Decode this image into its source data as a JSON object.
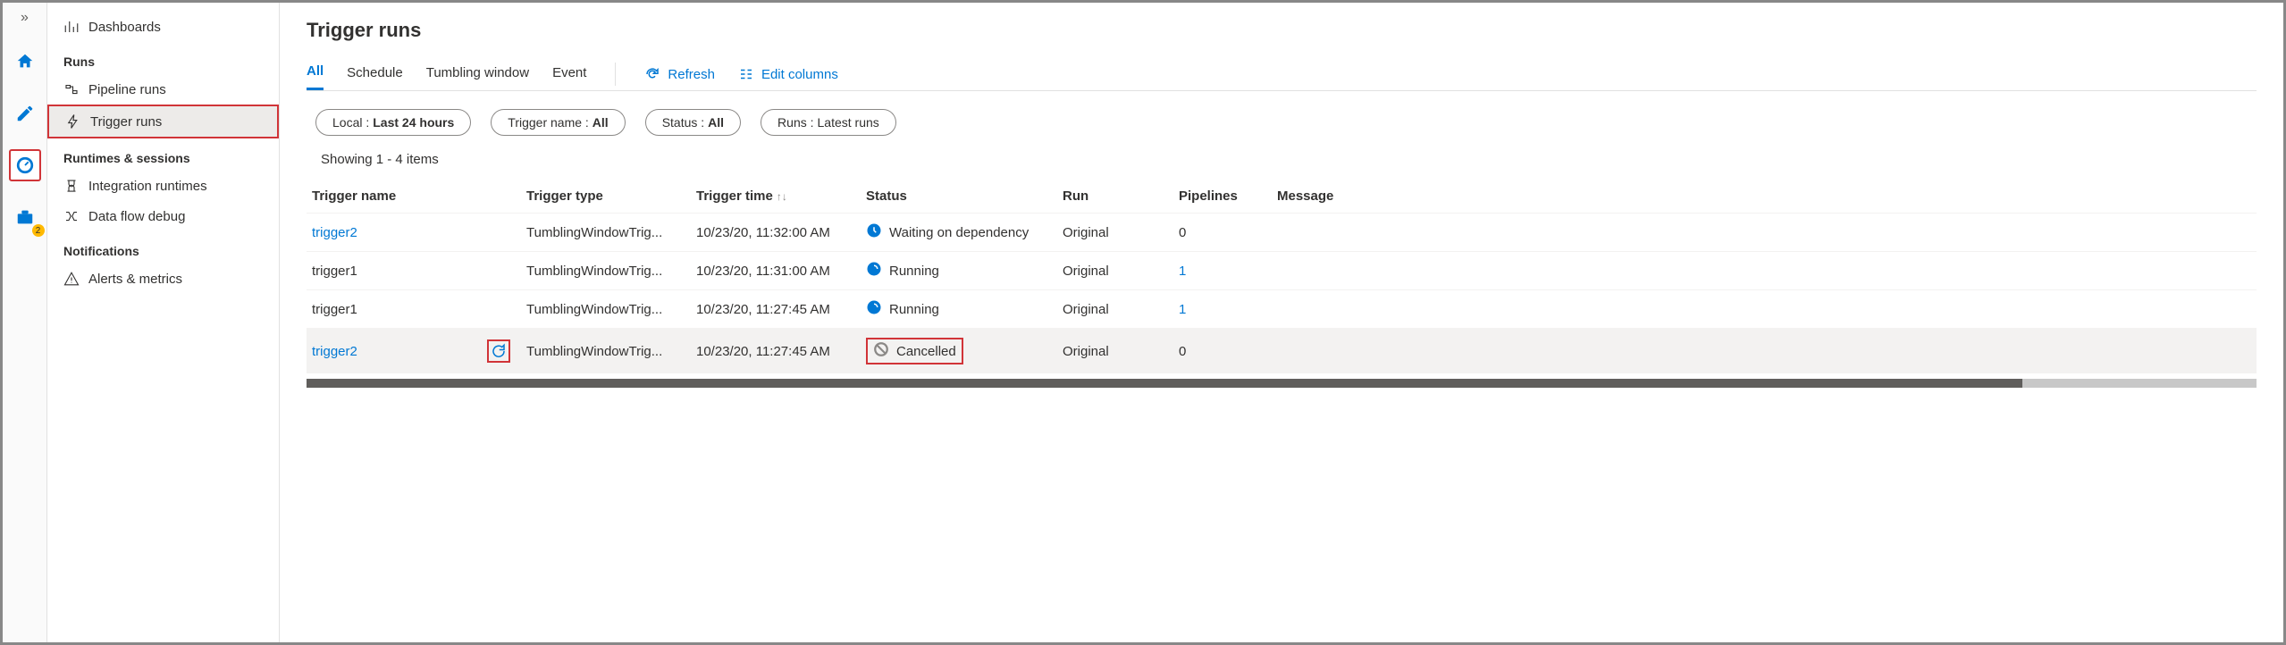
{
  "rail": {
    "badge": "2"
  },
  "sidebar": {
    "dashboards": "Dashboards",
    "h_runs": "Runs",
    "pipeline_runs": "Pipeline runs",
    "trigger_runs": "Trigger runs",
    "h_runtimes": "Runtimes & sessions",
    "integration_runtimes": "Integration runtimes",
    "dataflow_debug": "Data flow debug",
    "h_notifications": "Notifications",
    "alerts_metrics": "Alerts & metrics"
  },
  "title": "Trigger runs",
  "tabs": {
    "all": "All",
    "schedule": "Schedule",
    "tumbling": "Tumbling window",
    "event": "Event"
  },
  "actions": {
    "refresh": "Refresh",
    "edit_columns": "Edit columns"
  },
  "pills": {
    "local_k": "Local : ",
    "local_v": "Last 24 hours",
    "tname_k": "Trigger name : ",
    "tname_v": "All",
    "status_k": "Status : ",
    "status_v": "All",
    "runs_k": "Runs : ",
    "runs_v": "Latest runs"
  },
  "showing": "Showing 1 - 4 items",
  "columns": {
    "name": "Trigger name",
    "type": "Trigger type",
    "time": "Trigger time",
    "status": "Status",
    "run": "Run",
    "pipelines": "Pipelines",
    "message": "Message"
  },
  "rows": [
    {
      "name": "trigger2",
      "name_link": true,
      "type": "TumblingWindowTrig...",
      "time": "10/23/20, 11:32:00 AM",
      "status": "Waiting on dependency",
      "status_icon": "clock",
      "run": "Original",
      "pipelines": "0",
      "p_link": false,
      "hover": false,
      "rerun": false,
      "boxed": false
    },
    {
      "name": "trigger1",
      "name_link": false,
      "type": "TumblingWindowTrig...",
      "time": "10/23/20, 11:31:00 AM",
      "status": "Running",
      "status_icon": "spin",
      "run": "Original",
      "pipelines": "1",
      "p_link": true,
      "hover": false,
      "rerun": false,
      "boxed": false
    },
    {
      "name": "trigger1",
      "name_link": false,
      "type": "TumblingWindowTrig...",
      "time": "10/23/20, 11:27:45 AM",
      "status": "Running",
      "status_icon": "spin",
      "run": "Original",
      "pipelines": "1",
      "p_link": true,
      "hover": false,
      "rerun": false,
      "boxed": false
    },
    {
      "name": "trigger2",
      "name_link": true,
      "type": "TumblingWindowTrig...",
      "time": "10/23/20, 11:27:45 AM",
      "status": "Cancelled",
      "status_icon": "cancel",
      "run": "Original",
      "pipelines": "0",
      "p_link": false,
      "hover": true,
      "rerun": true,
      "boxed": true
    }
  ]
}
